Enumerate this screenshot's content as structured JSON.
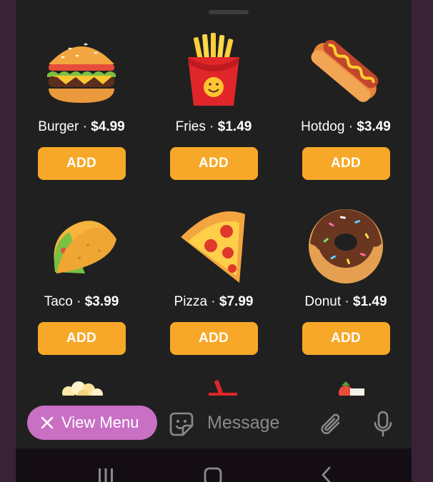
{
  "products": [
    {
      "name": "Burger",
      "separator": " · ",
      "price": "$4.99",
      "button": "ADD",
      "icon": "burger-icon"
    },
    {
      "name": "Fries",
      "separator": " · ",
      "price": "$1.49",
      "button": "ADD",
      "icon": "fries-icon"
    },
    {
      "name": "Hotdog",
      "separator": " · ",
      "price": "$3.49",
      "button": "ADD",
      "icon": "hotdog-icon"
    },
    {
      "name": "Taco",
      "separator": " · ",
      "price": "$3.99",
      "button": "ADD",
      "icon": "taco-icon"
    },
    {
      "name": "Pizza",
      "separator": " · ",
      "price": "$7.99",
      "button": "ADD",
      "icon": "pizza-icon"
    },
    {
      "name": "Donut",
      "separator": " · ",
      "price": "$1.49",
      "button": "ADD",
      "icon": "donut-icon"
    }
  ],
  "bottom_bar": {
    "view_menu_label": "View Menu",
    "message_placeholder": "Message"
  },
  "colors": {
    "add_button": "#f7a828",
    "view_menu_button": "#c96fc4",
    "sheet_background": "#202020",
    "frame": "#3a2236"
  }
}
